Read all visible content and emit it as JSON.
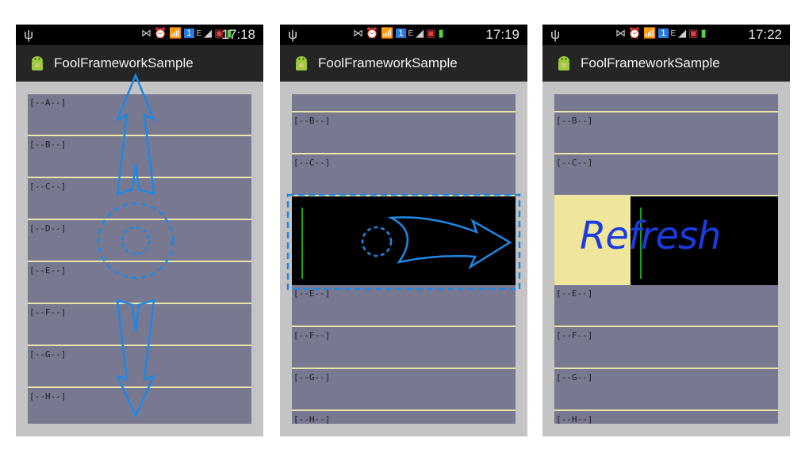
{
  "colors": {
    "list_bg": "#797891",
    "divider": "#eae5a8",
    "annotation_blue": "#1e88e5",
    "refresh_text": "#1a3be0",
    "refresh_bg": "#efe69c",
    "status_bar": "#000000",
    "app_bar": "#252525"
  },
  "screens": [
    {
      "status": {
        "time": "17:18",
        "network": "E",
        "sim": "1",
        "icons": [
          "usb-icon",
          "mute-icon",
          "alarm-icon",
          "wifi-icon",
          "sim-icon",
          "signal-icon",
          "no-sim-icon",
          "battery-icon"
        ]
      },
      "app_title": "FoolFrameworkSample",
      "items": [
        "[--A--]",
        "[--B--]",
        "[--C--]",
        "[--D--]",
        "[--E--]",
        "[--F--]",
        "[--G--]",
        "[--H--]"
      ]
    },
    {
      "status": {
        "time": "17:19",
        "network": "E",
        "sim": "1",
        "icons": [
          "usb-icon",
          "mute-icon",
          "alarm-icon",
          "wifi-icon",
          "sim-icon",
          "signal-icon",
          "no-sim-icon",
          "battery-icon"
        ]
      },
      "app_title": "FoolFrameworkSample",
      "items": [
        "[--B--]",
        "[--C--]",
        "[--E--]",
        "[--F--]",
        "[--G--]",
        "[--H--]"
      ]
    },
    {
      "status": {
        "time": "17:22",
        "network": "E",
        "sim": "1",
        "icons": [
          "usb-icon",
          "mute-icon",
          "alarm-icon",
          "wifi-icon",
          "sim-icon",
          "signal-icon",
          "no-sim-icon",
          "battery-icon"
        ]
      },
      "app_title": "FoolFrameworkSample",
      "items": [
        "[--B--]",
        "[--C--]",
        "[--E--]",
        "[--F--]",
        "[--G--]",
        "[--H--]"
      ],
      "refresh_label": "Refresh"
    }
  ]
}
